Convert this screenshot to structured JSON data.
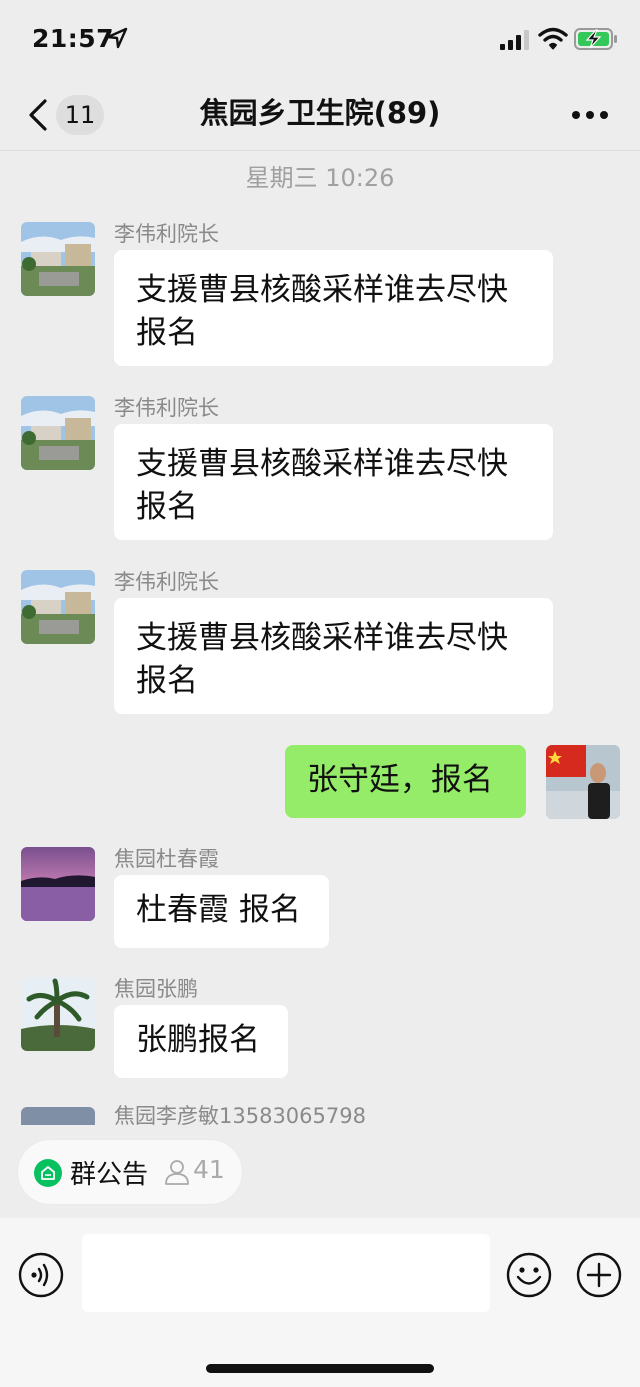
{
  "status_bar": {
    "time": "21:57"
  },
  "nav": {
    "unread_count": "11",
    "title": "焦园乡卫生院(89)"
  },
  "timestamp": "星期三 10:26",
  "messages": [
    {
      "sender": "李伟利院长",
      "text": "支援曹县核酸采样谁去尽快报名"
    },
    {
      "sender": "李伟利院长",
      "text": "支援曹县核酸采样谁去尽快报名"
    },
    {
      "sender": "李伟利院长",
      "text": "支援曹县核酸采样谁去尽快报名"
    },
    {
      "sender": "",
      "text": "张守廷，报名",
      "outgoing": true
    },
    {
      "sender": "焦园杜春霞",
      "text": "杜春霞 报名"
    },
    {
      "sender": "焦园张鹏",
      "text": "张鹏报名"
    },
    {
      "sender": "焦园李彦敏13583065798",
      "text": ""
    }
  ],
  "announcement": {
    "label": "群公告",
    "member_count": "41"
  },
  "colors": {
    "outgoing_bubble": "#95ec69",
    "incoming_bubble": "#ffffff",
    "background": "#ededed",
    "accent_green": "#07c160"
  }
}
